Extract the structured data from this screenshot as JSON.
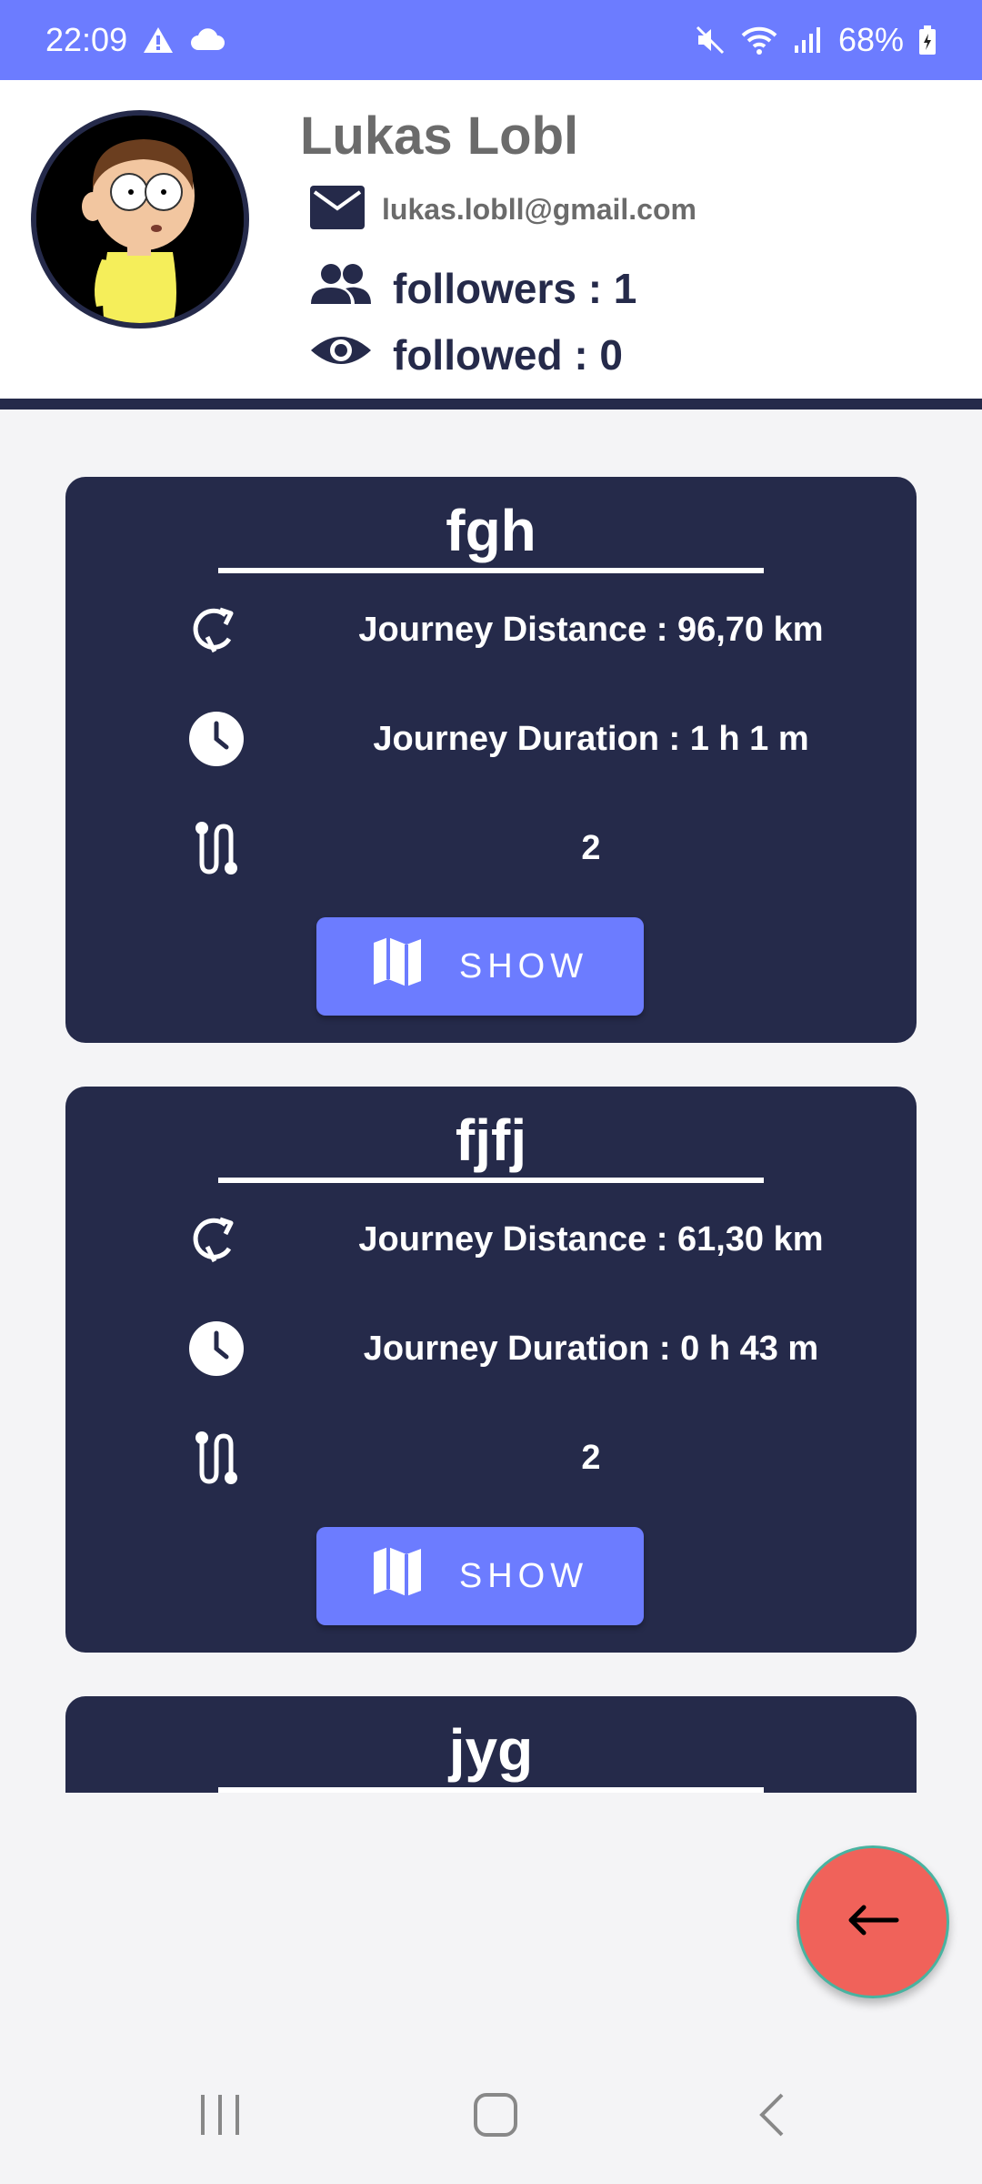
{
  "status_bar": {
    "time": "22:09",
    "battery": "68%",
    "icons": [
      "warning-icon",
      "cloud-icon",
      "mute-icon",
      "wifi-icon",
      "signal-icon",
      "battery-icon"
    ]
  },
  "profile": {
    "name": "Lukas Lobl",
    "email": "lukas.lobll@gmail.com",
    "followers": "followers : 1",
    "followed": "followed : 0"
  },
  "journeys": [
    {
      "title": "fgh",
      "distance": "Journey Distance : 96,70 km",
      "duration": "Journey Duration : 1 h 1 m",
      "steps": "2",
      "button_label": "SHOW"
    },
    {
      "title": "fjfj",
      "distance": "Journey Distance : 61,30 km",
      "duration": "Journey Duration : 0 h 43 m",
      "steps": "2",
      "button_label": "SHOW"
    },
    {
      "title": "jyg"
    }
  ],
  "colors": {
    "status_bar": "#6c7cff",
    "card": "#252a4a",
    "button": "#6c7cff",
    "fab": "#f0625a",
    "background": "#f4f4f6"
  }
}
